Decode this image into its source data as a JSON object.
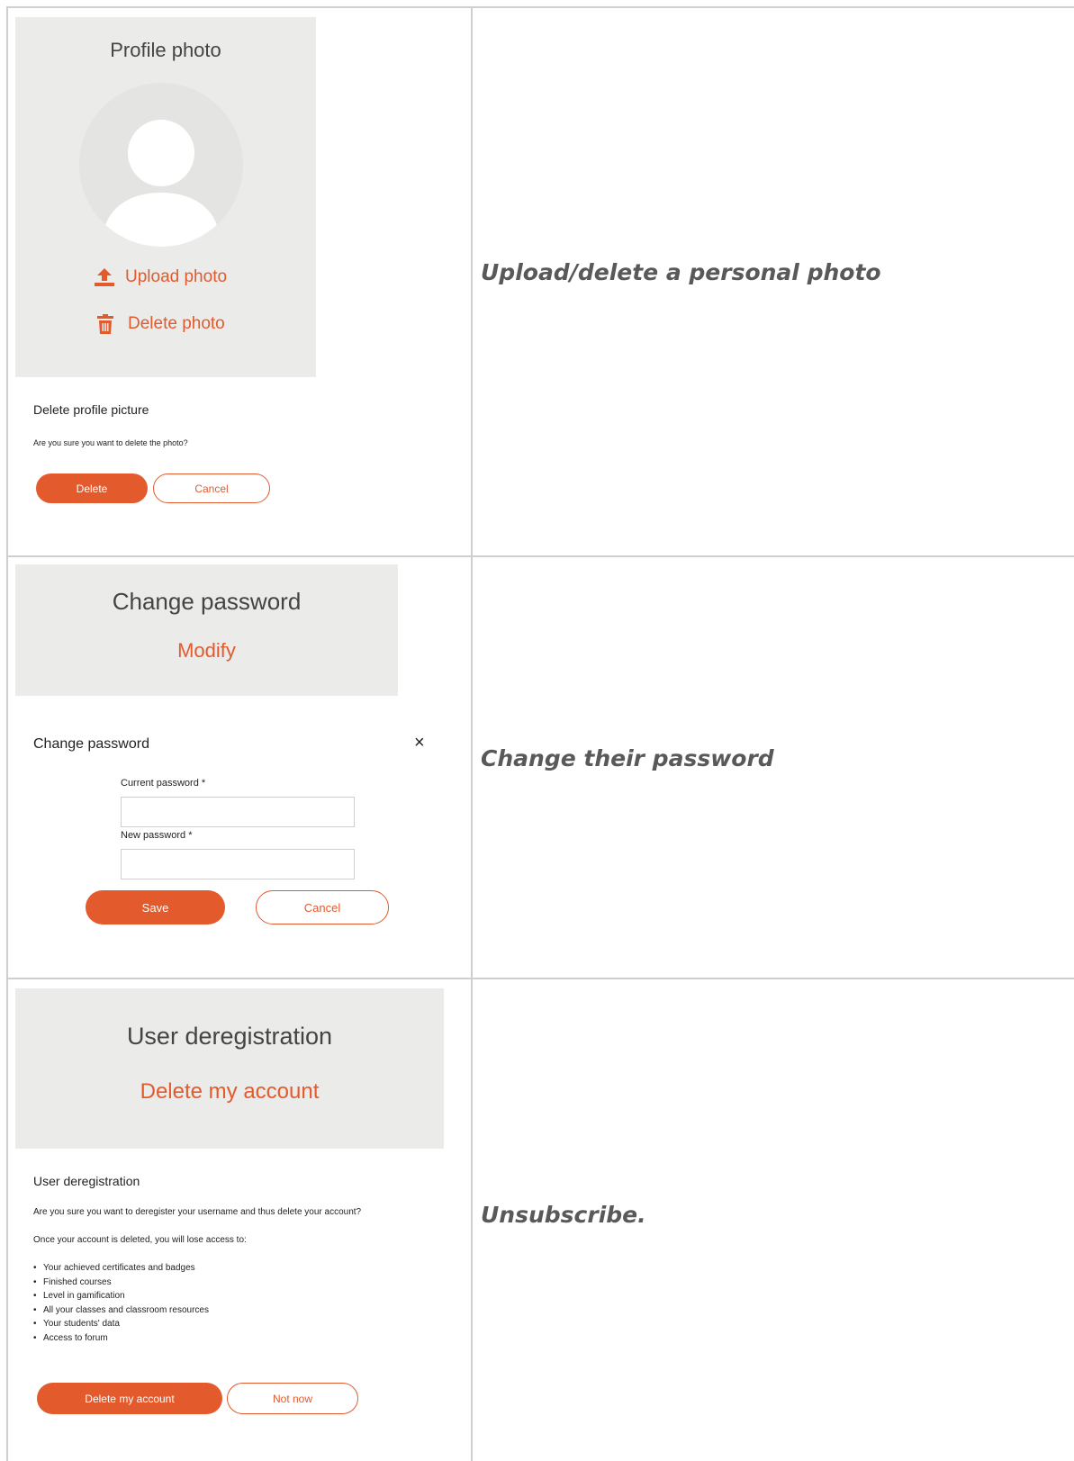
{
  "profile_photo": {
    "panel_title": "Profile photo",
    "upload_label": "Upload photo",
    "delete_label": "Delete photo",
    "dialog": {
      "title": "Delete profile picture",
      "message": "Are you sure you want to delete the photo?",
      "confirm_label": "Delete",
      "cancel_label": "Cancel"
    },
    "caption": "Upload/delete a personal photo"
  },
  "change_password": {
    "panel_title": "Change password",
    "modify_label": "Modify",
    "dialog": {
      "title": "Change password",
      "close_glyph": "×",
      "current_label": "Current password *",
      "current_value": "",
      "new_label": "New password *",
      "new_value": "",
      "save_label": "Save",
      "cancel_label": "Cancel"
    },
    "caption": "Change their password"
  },
  "deregistration": {
    "panel_title": "User deregistration",
    "delete_link": "Delete my account",
    "dialog": {
      "title": "User deregistration",
      "question": "Are you sure you want to deregister your username and thus delete your account?",
      "intro": "Once your account is deleted, you will lose access to:",
      "items": [
        "Your achieved certificates and badges",
        "Finished courses",
        "Level in gamification",
        "All your classes and classroom resources",
        "Your students' data",
        "Access to forum"
      ],
      "confirm_label": "Delete my account",
      "cancel_label": "Not now"
    },
    "caption": "Unsubscribe."
  },
  "colors": {
    "accent": "#e35a2d",
    "panel_bg": "#ebebea",
    "grid": "#cfcfcf",
    "caption": "#595959"
  },
  "icons": [
    "upload-icon",
    "trash-icon",
    "avatar-icon",
    "close-icon"
  ]
}
